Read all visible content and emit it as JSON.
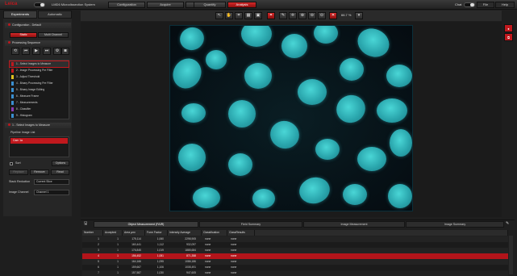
{
  "topbar": {
    "logo": "Leica",
    "system_name": "LMD6 Microdissection System",
    "nav_tabs": [
      "Configuration",
      "Acquire",
      "Process",
      "Quantify",
      "Analysis"
    ],
    "active_nav": "Analysis",
    "chat_label": "Chat",
    "file_label": "File",
    "help_label": "Help"
  },
  "left": {
    "tabs": [
      "Experiments",
      "Automatic"
    ],
    "config_section": "Configuration - Default",
    "single_btn": "Static",
    "multi_btn": "Multi Channel",
    "processing_section": "Processing Sequence",
    "sequence": [
      "1 - Select Images to Measure",
      "2 - Image Processing Pre Filter",
      "3 - Adjust Threshold",
      "4 - Binary Processing Pre Filter",
      "5 - Binary Image Editing",
      "6 - Measure Frame",
      "7 - Measurements",
      "8 - Classifier",
      "9 - Histogram"
    ],
    "sequence_colors": [
      "#c0181d",
      "#c0181d",
      "#e0c020",
      "#3a8fd0",
      "#3a8fd0",
      "#3a8fd0",
      "#3a8fd0",
      "#8a3ab0",
      "#3a8fd0"
    ],
    "select_section": "1 - Select Images to Measure",
    "pipeline_label": "Pipeline Image List",
    "pipeline_item": "Cam 1a",
    "sort_label": "Sort",
    "options_label": "Options",
    "btn_replace": "Replace",
    "btn_remove": "Remove",
    "btn_read": "Read",
    "stack_label": "Stack Reduction",
    "stack_value": "Current Slice",
    "channel_label": "Image Channel",
    "channel_value": "Channel 1"
  },
  "viewer": {
    "zoom": "66.7 %"
  },
  "bottom": {
    "tabs": [
      "Object Measurement (FAIR)",
      "Field Summary",
      "Image Measurement",
      "Image Summary"
    ],
    "columns": [
      "Number",
      "Accepted",
      "Area µm²",
      "Form Factor",
      "Intensity Average",
      "Classification",
      "ClassResults"
    ],
    "rows": [
      [
        "1",
        "1",
        "175,114",
        "1,060",
        "2298,905",
        "none",
        "none"
      ],
      [
        "2",
        "1",
        "160,441",
        "1,112",
        "932,097",
        "none",
        "none"
      ],
      [
        "3",
        "1",
        "176,845",
        "1,019",
        "1885,684",
        "none",
        "none"
      ],
      [
        "4",
        "1",
        "156,452",
        "1,081",
        "871,358",
        "none",
        "none"
      ],
      [
        "5",
        "1",
        "164,166",
        "1,095",
        "1086,186",
        "none",
        "none"
      ],
      [
        "6",
        "1",
        "159,667",
        "1,106",
        "1008,491",
        "none",
        "none"
      ],
      [
        "7",
        "1",
        "157,587",
        "1,030",
        "947,605",
        "none",
        "none"
      ]
    ],
    "selected_row": 3
  }
}
